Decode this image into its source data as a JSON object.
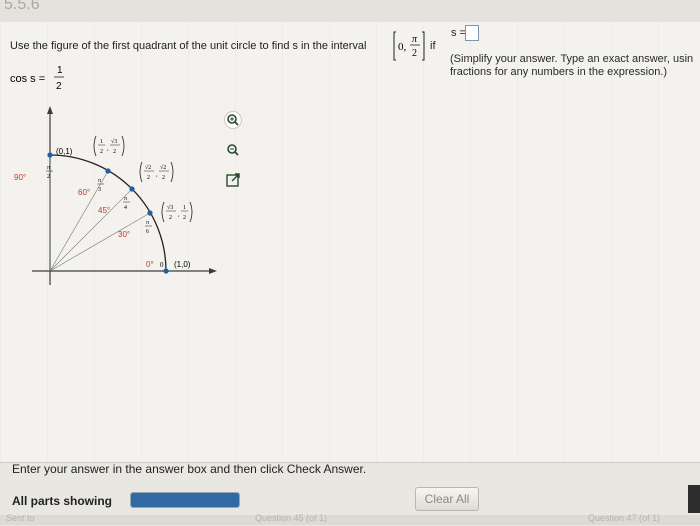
{
  "header": {
    "title": "5.5.6"
  },
  "question": {
    "prompt": "Use the figure of the first quadrant of the unit circle to find s in the interval",
    "interval_left": "0,",
    "interval_num": "π",
    "interval_den": "2",
    "if_word": "if",
    "s_label": "s =",
    "hint_line1": "(Simplify your answer. Type an exact answer, usin",
    "hint_line2": "fractions for any numbers in the expression.)",
    "given_lhs": "cos s =",
    "given_num": "1",
    "given_den": "2"
  },
  "figure": {
    "point_0_1": "(0,1)",
    "point_1_0": "(1,0)",
    "deg_90": "90°",
    "deg_60": "60°",
    "deg_45": "45°",
    "deg_30": "30°",
    "deg_0": "0°",
    "pi": "π",
    "den_2": "2",
    "den_3": "3",
    "den_4": "4",
    "den_6": "6",
    "zero": "0",
    "one": "1",
    "sqrt3": "√3",
    "sqrt2": "√2"
  },
  "tools": [
    "zoom-in-icon",
    "zoom-out-icon",
    "popout-icon"
  ],
  "footer": {
    "instruction": "Enter your answer in the answer box and then click Check Answer.",
    "parts_label": "All parts showing",
    "progress": 1.0,
    "clear_all": "Clear All",
    "bottom_left": "Sent to",
    "bottom_mid": "Question 45 (of 1)",
    "bottom_right": "Question 47 (of 1)"
  },
  "colors": {
    "accent": "#2f6aa3",
    "point": "#1f5fa8",
    "axis": "#3c3c3c"
  }
}
